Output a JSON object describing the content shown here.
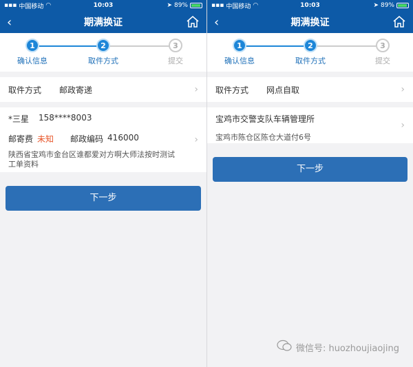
{
  "status": {
    "carrier": "中国移动",
    "time": "10:03",
    "battery": "89%",
    "battery_level": 0.89
  },
  "left": {
    "title": "期满换证",
    "steps": [
      {
        "num": "1",
        "label": "确认信息"
      },
      {
        "num": "2",
        "label": "取件方式"
      },
      {
        "num": "3",
        "label": "提交"
      }
    ],
    "pickup_label": "取件方式",
    "pickup_value": "邮政寄递",
    "recipient_name": "*三星",
    "recipient_phone": "158****8003",
    "postage_label": "邮寄费",
    "postage_value": "未知",
    "postcode_label": "邮政编码",
    "postcode_value": "416000",
    "address": "陕西省宝鸡市金台区谁都爱对方啊大师法按时测试工单资料",
    "next_button": "下一步"
  },
  "right": {
    "title": "期满换证",
    "steps": [
      {
        "num": "1",
        "label": "确认信息"
      },
      {
        "num": "2",
        "label": "取件方式"
      },
      {
        "num": "3",
        "label": "提交"
      }
    ],
    "pickup_label": "取件方式",
    "pickup_value": "网点自取",
    "office_name": "宝鸡市交警支队车辆管理所",
    "office_address": "宝鸡市陈仓区陈仓大道付6号",
    "next_button": "下一步"
  },
  "watermark": "微信号: huozhoujiaojing",
  "colors": {
    "primary": "#0d5aa7",
    "accent": "#1d86d8",
    "warning": "#e8562a",
    "background": "#f2f2f4"
  }
}
